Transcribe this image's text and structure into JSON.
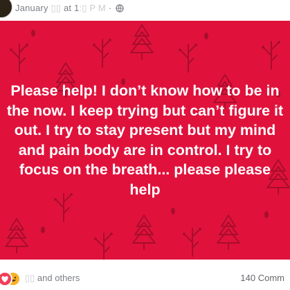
{
  "post": {
    "meta_text": "January ",
    "meta_time": "at 1",
    "meta_sep": " · ",
    "message_lines": [
      "Please help! I don’t know how to be in",
      "the now. I keep trying but can’t figure it",
      "out. I try to stay present but my mind",
      "and pain body are in control. I try to",
      "focus on the breath... please please",
      "help"
    ],
    "background_color": "#e0123c",
    "text_color": "#ffffff"
  },
  "footer": {
    "reaction_summary": "and others",
    "comment_count": "140 Comm",
    "reactions": [
      "love-icon",
      "haha-icon"
    ]
  }
}
